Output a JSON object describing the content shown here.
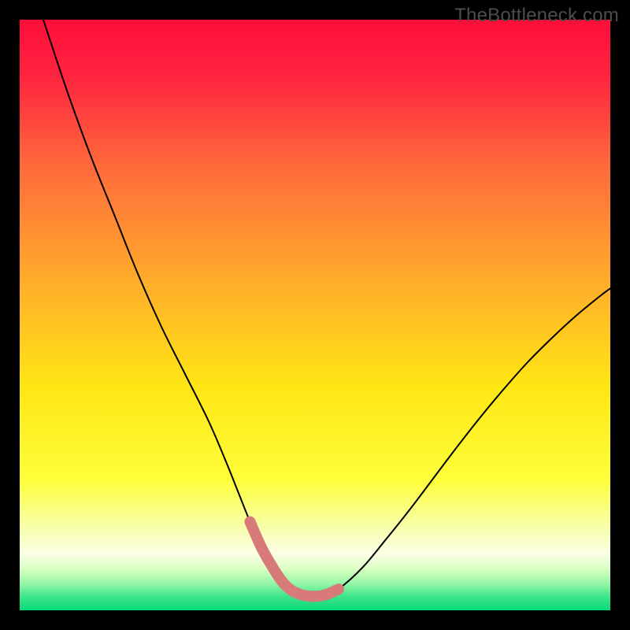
{
  "watermark": "TheBottleneck.com",
  "chart_data": {
    "type": "line",
    "title": "",
    "xlabel": "",
    "ylabel": "",
    "xlim": [
      0,
      100
    ],
    "ylim": [
      0,
      100
    ],
    "gradient_stops": [
      {
        "pos": 0,
        "color": "#ff0d3a"
      },
      {
        "pos": 0.1,
        "color": "#ff2640"
      },
      {
        "pos": 0.25,
        "color": "#ff6b3b"
      },
      {
        "pos": 0.45,
        "color": "#ffaf2a"
      },
      {
        "pos": 0.62,
        "color": "#ffe614"
      },
      {
        "pos": 0.78,
        "color": "#feff3a"
      },
      {
        "pos": 0.86,
        "color": "#f7ffad"
      },
      {
        "pos": 0.905,
        "color": "#fbffe6"
      },
      {
        "pos": 0.93,
        "color": "#d9ffc2"
      },
      {
        "pos": 0.955,
        "color": "#94f7a6"
      },
      {
        "pos": 0.975,
        "color": "#44e58b"
      },
      {
        "pos": 1.0,
        "color": "#06d978"
      }
    ],
    "series": [
      {
        "name": "bottleneck-curve",
        "color": "#000000",
        "x": [
          4,
          8,
          12,
          16,
          20,
          24,
          28,
          32,
          35,
          37,
          39,
          41,
          43,
          44.5,
          46,
          47.5,
          49,
          50.5,
          52,
          54,
          58,
          62,
          66,
          70,
          74,
          78,
          82,
          86,
          90,
          94,
          98,
          100
        ],
        "y": [
          100,
          88,
          77,
          67,
          57,
          48,
          40,
          32,
          25,
          20,
          15,
          10.5,
          7,
          4.8,
          3.4,
          2.7,
          2.4,
          2.4,
          2.7,
          3.6,
          7.2,
          12,
          17,
          22.3,
          27.6,
          32.7,
          37.5,
          42,
          46,
          49.7,
          53,
          54.5
        ]
      },
      {
        "name": "optimal-band",
        "color": "#d97a7a",
        "x": [
          39,
          41,
          43,
          44.5,
          46,
          47.5,
          49,
          50.5,
          52,
          54
        ],
        "y": [
          15,
          10.5,
          7,
          4.8,
          3.4,
          2.7,
          2.4,
          2.4,
          2.7,
          3.6
        ]
      }
    ]
  }
}
